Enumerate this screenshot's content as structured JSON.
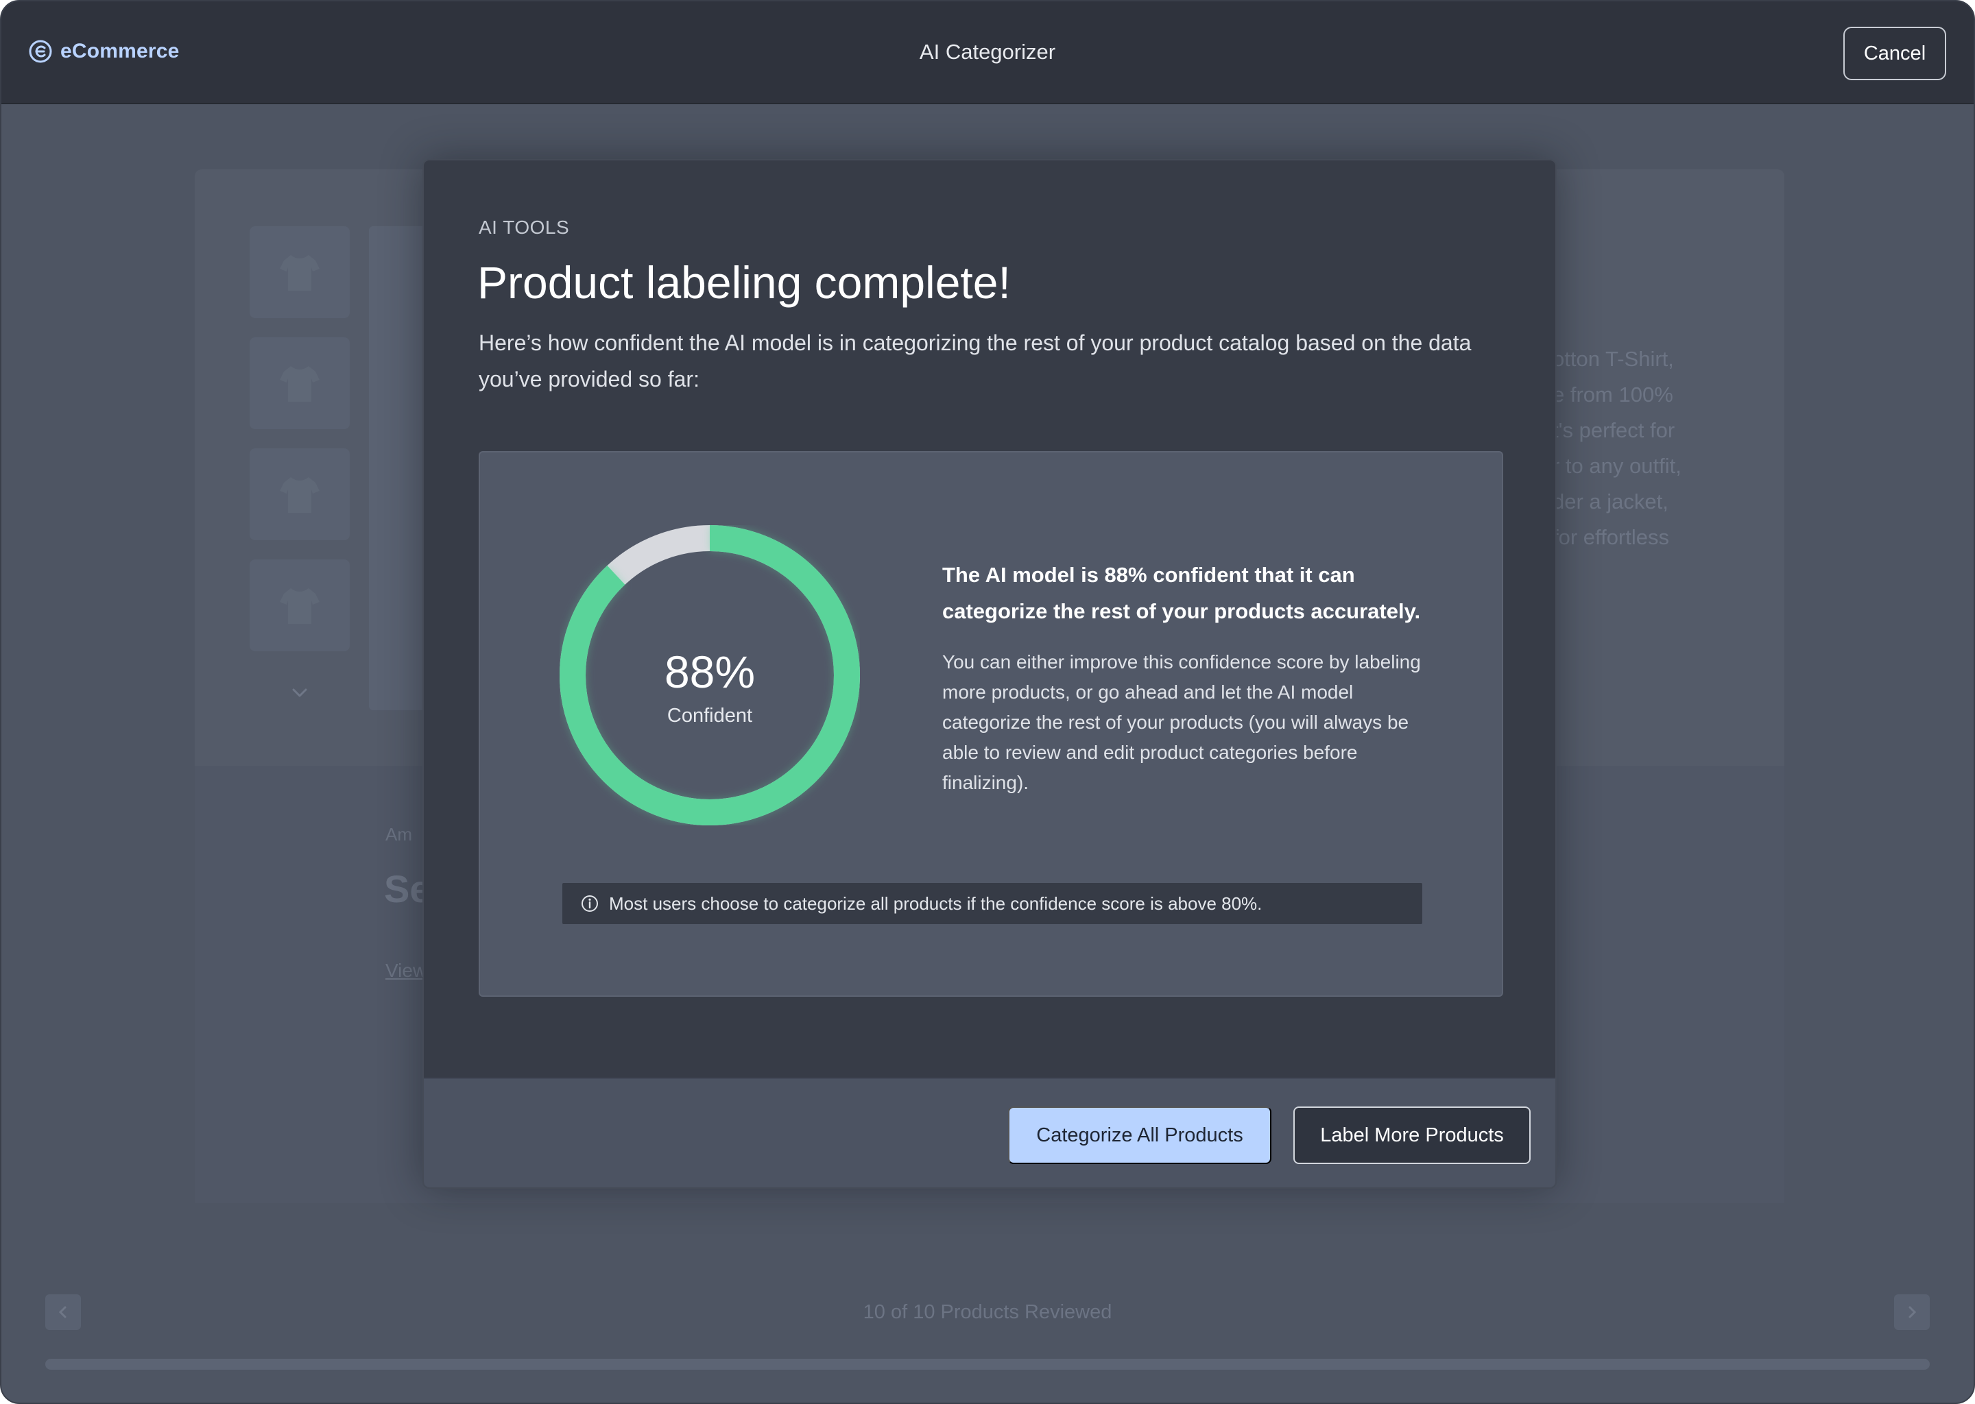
{
  "app": {
    "brand": "eCommerce",
    "title": "AI Categorizer",
    "cancel_label": "Cancel"
  },
  "background": {
    "description_fragments": [
      "otton T-Shirt,",
      "e from 100%",
      "t's perfect for",
      "r to any outfit,",
      "der a jacket,",
      "for effortless"
    ],
    "meta": "Am",
    "heading": "Se",
    "link": "View",
    "footer_status": "10 of 10 Products Reviewed"
  },
  "modal": {
    "eyebrow": "AI TOOLS",
    "title": "Product labeling complete!",
    "subtitle": "Here’s how confident the AI model is in categorizing the rest of your product catalog based on the data you’ve provided so far:",
    "confidence": {
      "value": 88,
      "value_label": "88%",
      "label": "Confident",
      "color_filled": "#5ad49a",
      "color_remaining": "#d7d9de"
    },
    "headline": "The AI model is 88% confident that it can categorize the rest of your products accurately.",
    "body": "You can either improve this confidence score by labeling more products, or go ahead and let the AI model categorize the rest of your products (you will always be able to review and edit product categories before finalizing).",
    "hint": "Most users choose to categorize all products if the confidence score is above 80%.",
    "primary_button": "Categorize All Products",
    "secondary_button": "Label More Products"
  },
  "colors": {
    "accent": "#b8d3ff",
    "success": "#5ad49a"
  }
}
